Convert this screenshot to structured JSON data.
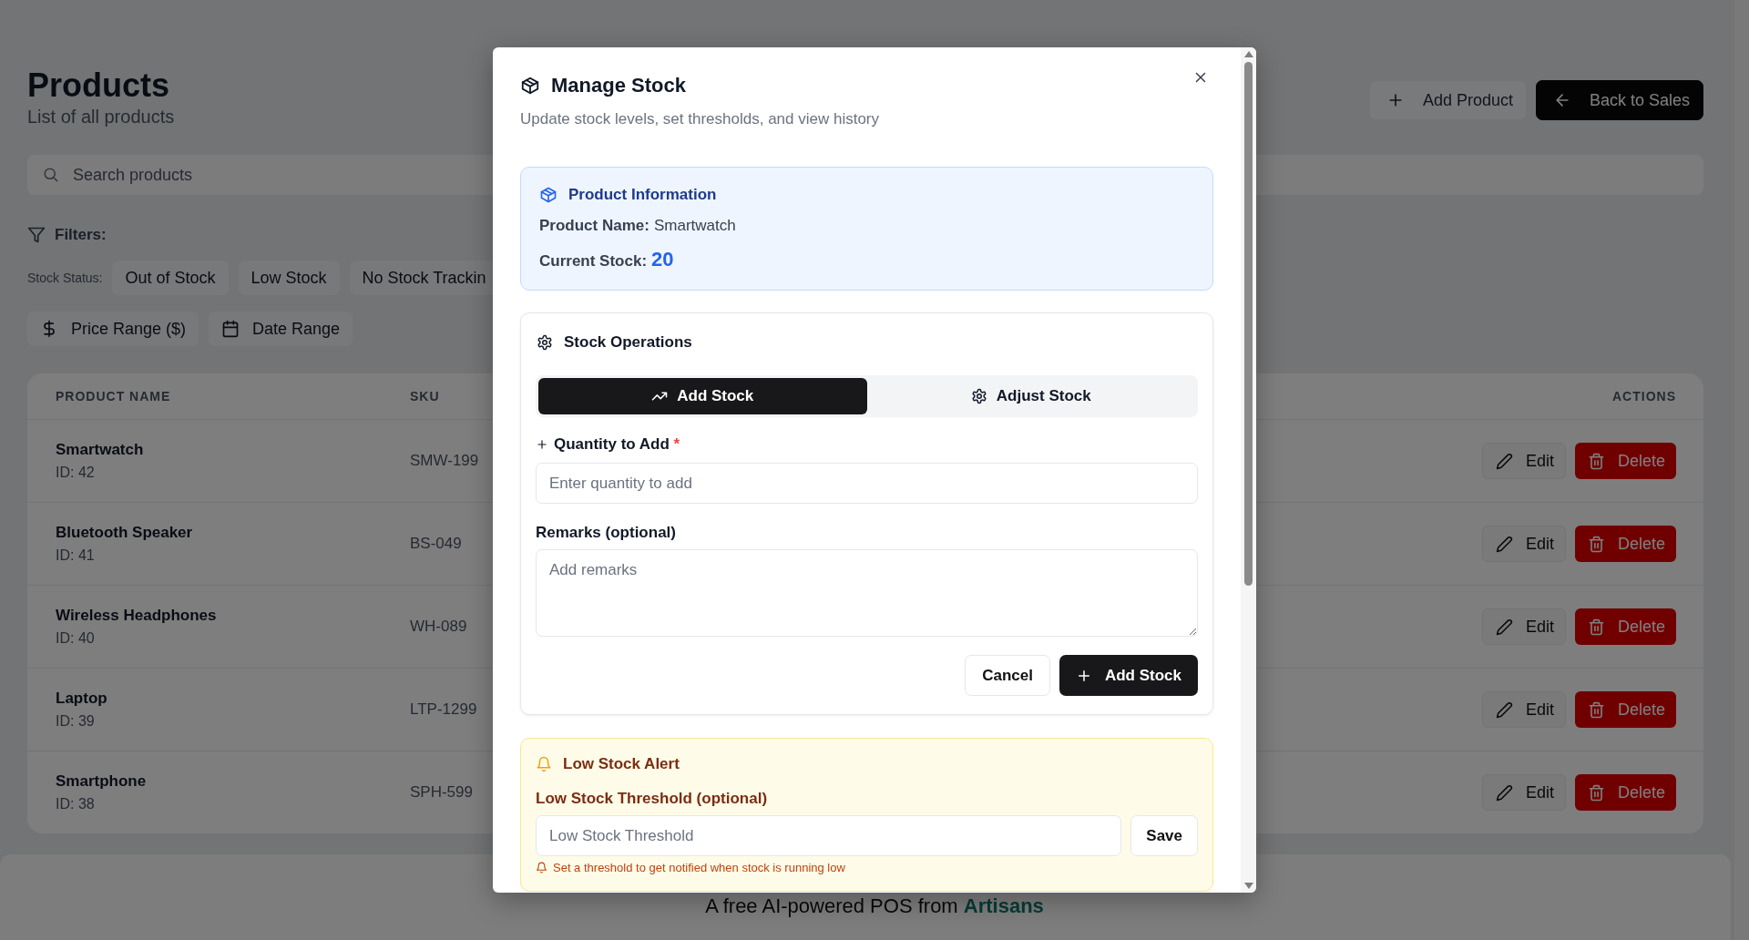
{
  "page": {
    "title": "Products",
    "subtitle": "List of all products",
    "actions": [
      {
        "label": "Add Product",
        "kind": "outline"
      },
      {
        "label": "Back to Sales",
        "kind": "primary"
      }
    ]
  },
  "search": {
    "placeholder": "Search products"
  },
  "filters": {
    "label": "Filters:",
    "stock_status_label": "Stock Status:",
    "stock_status": [
      {
        "label": "Out of Stock",
        "selected": false
      },
      {
        "label": "Low Stock",
        "selected": false
      },
      {
        "label": "No Stock Trackin",
        "selected": false
      }
    ],
    "ranges": [
      {
        "label": "Price Range ($)",
        "kind": "price"
      },
      {
        "label": "Date Range",
        "kind": "date"
      }
    ]
  },
  "table": {
    "columns": [
      "PRODUCT NAME",
      "SKU",
      "ACTIONS"
    ],
    "rows": [
      {
        "name": "Smartwatch",
        "id": "ID: 42",
        "sku": "SMW-199",
        "actions": [
          {
            "label": "Edit",
            "kind": "edit"
          },
          {
            "label": "Delete",
            "kind": "delete"
          }
        ]
      },
      {
        "name": "Bluetooth Speaker",
        "id": "ID: 41",
        "sku": "BS-049",
        "actions": [
          {
            "label": "Edit",
            "kind": "edit"
          },
          {
            "label": "Delete",
            "kind": "delete"
          }
        ]
      },
      {
        "name": "Wireless Headphones",
        "id": "ID: 40",
        "sku": "WH-089",
        "actions": [
          {
            "label": "Edit",
            "kind": "edit"
          },
          {
            "label": "Delete",
            "kind": "delete"
          }
        ]
      },
      {
        "name": "Laptop",
        "id": "ID: 39",
        "sku": "LTP-1299",
        "actions": [
          {
            "label": "Edit",
            "kind": "edit"
          },
          {
            "label": "Delete",
            "kind": "delete"
          }
        ]
      },
      {
        "name": "Smartphone",
        "id": "ID: 38",
        "sku": "SPH-599",
        "actions": [
          {
            "label": "Edit",
            "kind": "edit"
          },
          {
            "label": "Delete",
            "kind": "delete"
          }
        ]
      }
    ]
  },
  "footer": {
    "text": "A free AI-powered POS from",
    "link": "Artisans"
  },
  "modal": {
    "title": "Manage Stock",
    "subtitle": "Update stock levels, set thresholds, and view history",
    "product_info": {
      "title": "Product Information",
      "fields": [
        {
          "label": "Product Name:",
          "value": "Smartwatch",
          "kind": "text"
        },
        {
          "label": "Current Stock:",
          "value": "20",
          "kind": "highlight"
        }
      ]
    },
    "stock_operations": {
      "title": "Stock Operations",
      "tabs": [
        {
          "label": "Add Stock",
          "kind": "add",
          "selected": true
        },
        {
          "label": "Adjust Stock",
          "kind": "adjust",
          "selected": false
        }
      ],
      "quantity": {
        "label": "Quantity to Add",
        "required_mark": "*",
        "placeholder": "Enter quantity to add"
      },
      "remarks": {
        "label": "Remarks (optional)",
        "placeholder": "Add remarks"
      },
      "buttons": [
        {
          "label": "Cancel",
          "kind": "outline"
        },
        {
          "label": "Add Stock",
          "kind": "primary"
        }
      ]
    },
    "low_stock_alert": {
      "title": "Low Stock Alert",
      "threshold_label": "Low Stock Threshold (optional)",
      "placeholder": "Low Stock Threshold",
      "save": "Save",
      "hint": "Set a threshold to get notified when stock is running low"
    }
  }
}
